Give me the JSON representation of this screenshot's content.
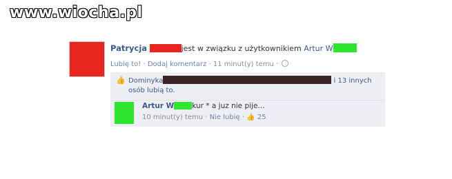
{
  "watermark": "www.wiocha.pl",
  "story": {
    "author": "Patrycja",
    "text": "jest w związku z użytkownikiem",
    "partner": "Artur W",
    "actions": {
      "like": "Lubię to!",
      "separator": "·",
      "comment": "Dodaj komentarz",
      "time": "11 minut(y) temu"
    }
  },
  "likes": {
    "first_name": "Dominyka",
    "suffix": "i 13 innych osób lubią to."
  },
  "comment": {
    "author": "Artur W",
    "author_suffix": "kur",
    "text": "* a juz nie pije…",
    "time": "10 minut(y) temu",
    "unlike": "Nie lubię",
    "like_count": "25"
  },
  "colors": {
    "link_blue": "#3b5998",
    "meta_gray": "#8c8c8c",
    "redact_red": "#e8261f",
    "redact_green": "#2de62d",
    "panel_bg": "#edeff4"
  }
}
